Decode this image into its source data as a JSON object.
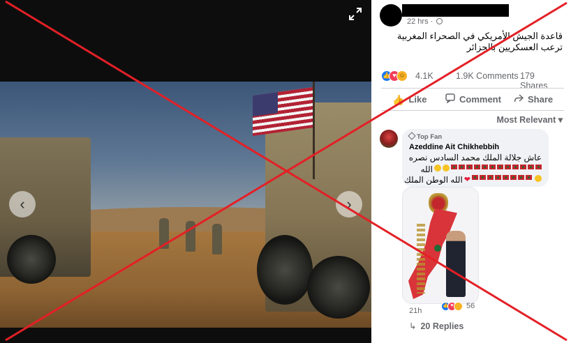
{
  "post": {
    "time": "22 hrs · ",
    "text": "قاعدة الجيش الأمريكي في الصحراء المغربية ترعب العسكريين بالجزائر",
    "reactions_count": "4.1K",
    "comments_count": "1.9K Comments",
    "shares_count": "179 Shares"
  },
  "actions": {
    "like": "Like",
    "comment": "Comment",
    "share": "Share"
  },
  "sort_label": "Most Relevant",
  "comment": {
    "badge": "Top Fan",
    "author": "Azeddine Ait Chikhebbih",
    "line1": "عاش جلالة الملك محمد السادس نصره",
    "line2_text": "الله",
    "line3_text": "الله الوطن الملك",
    "time": "21h",
    "reaction_count": "56",
    "replies": "20 Replies"
  },
  "icons": {
    "prev": "chevron-left-icon",
    "next": "chevron-right-icon",
    "expand": "expand-icon",
    "globe": "globe-icon",
    "like": "thumbs-up-icon",
    "comment": "speech-bubble-icon",
    "share": "share-arrow-icon"
  },
  "colors": {
    "like_blue": "#1877f2",
    "love_red": "#f33e58",
    "haha_yellow": "#f7b125",
    "overlay_red": "#e32026",
    "muted_text": "#65676b"
  }
}
